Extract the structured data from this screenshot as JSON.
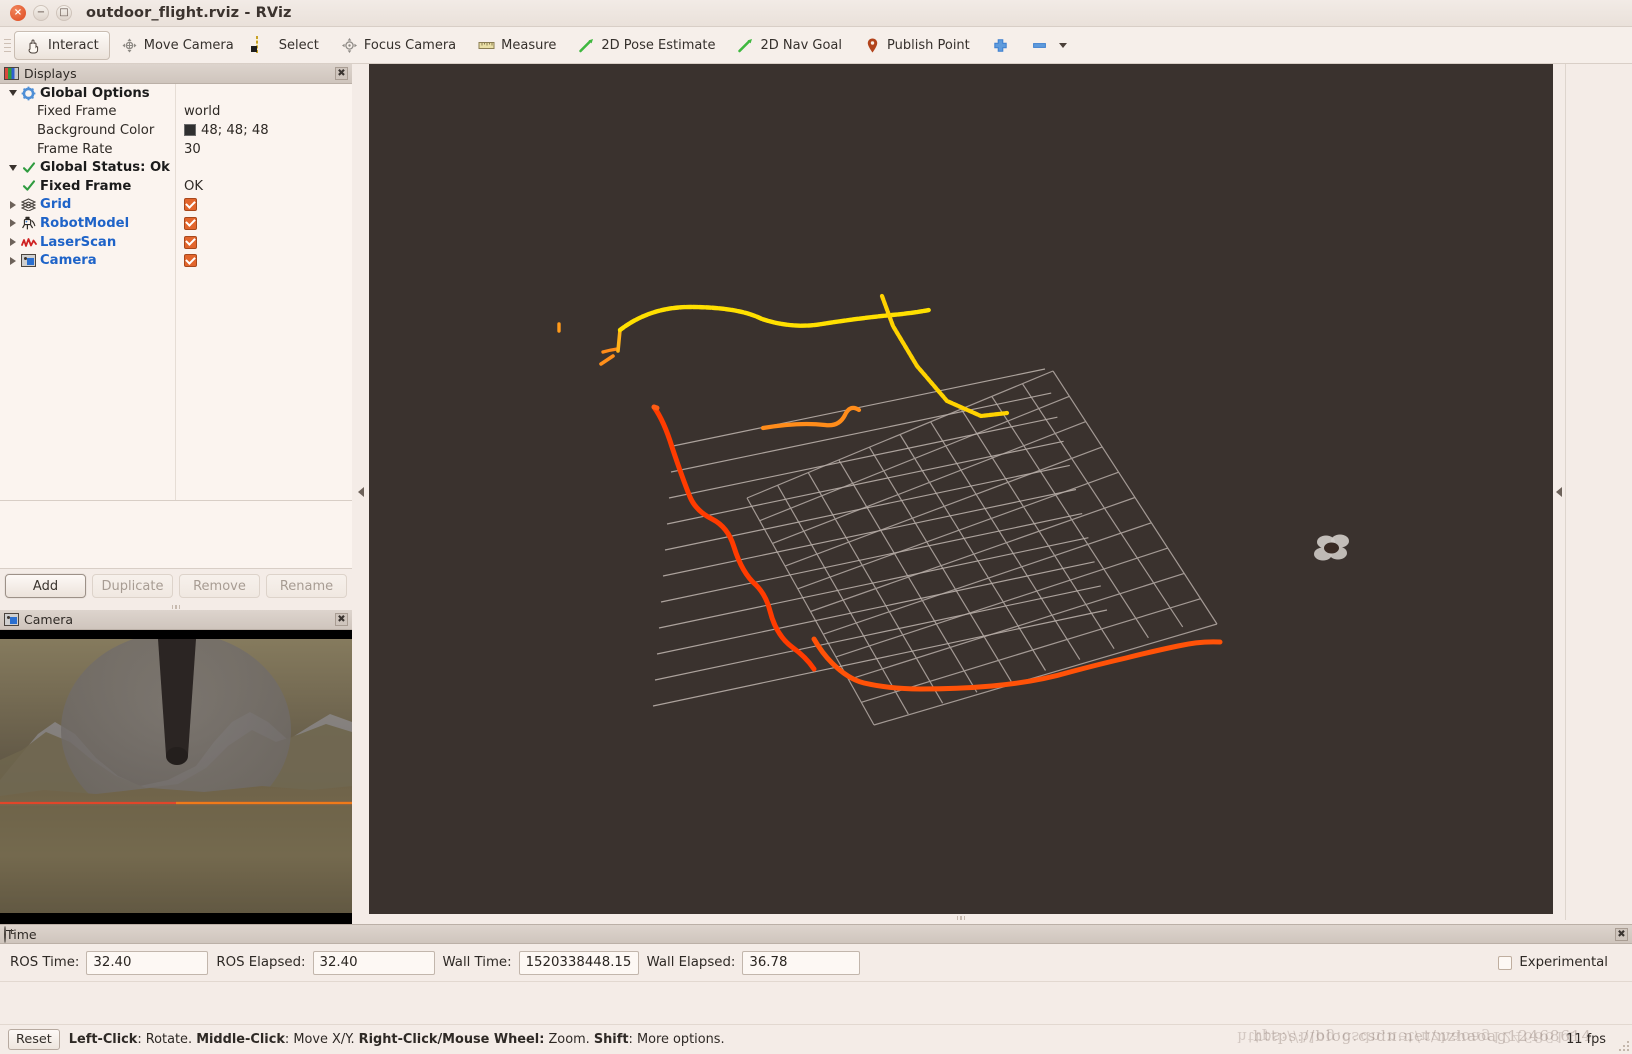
{
  "window": {
    "title": "outdoor_flight.rviz - RViz",
    "controls": {
      "close": "×",
      "minimize": "−",
      "maximize": "□"
    }
  },
  "toolbar": {
    "items": [
      {
        "label": "Interact",
        "icon": "hand-icon",
        "active": true
      },
      {
        "label": "Move Camera",
        "icon": "move-camera-icon",
        "active": false
      },
      {
        "label": "Select",
        "icon": "select-icon",
        "active": false
      },
      {
        "label": "Focus Camera",
        "icon": "focus-camera-icon",
        "active": false
      },
      {
        "label": "Measure",
        "icon": "measure-icon",
        "active": false
      },
      {
        "label": "2D Pose Estimate",
        "icon": "pose-arrow-icon",
        "active": false
      },
      {
        "label": "2D Nav Goal",
        "icon": "nav-goal-arrow-icon",
        "active": false
      },
      {
        "label": "Publish Point",
        "icon": "map-pin-icon",
        "active": false
      }
    ],
    "add_tool_icon": "plus-icon",
    "remove_tool_icon": "minus-icon",
    "remove_tool_caret": "chevron-down-icon"
  },
  "displays_panel": {
    "title": "Displays",
    "icon": "displays-icon",
    "close_label": "✖",
    "rows": [
      {
        "indent": 0,
        "twisty": "down",
        "icon": "gear-icon",
        "name": "Global Options",
        "style": "bold",
        "value": "",
        "value_type": "none"
      },
      {
        "indent": 1,
        "twisty": "none",
        "icon": "none",
        "name": "Fixed Frame",
        "style": "plain",
        "value": "world",
        "value_type": "text"
      },
      {
        "indent": 1,
        "twisty": "none",
        "icon": "none",
        "name": "Background Color",
        "style": "plain",
        "value": "48; 48; 48",
        "value_type": "color",
        "color": "#303030"
      },
      {
        "indent": 1,
        "twisty": "none",
        "icon": "none",
        "name": "Frame Rate",
        "style": "plain",
        "value": "30",
        "value_type": "text"
      },
      {
        "indent": 0,
        "twisty": "down",
        "icon": "check-green-icon",
        "name": "Global Status: Ok",
        "style": "bold",
        "value": "",
        "value_type": "none"
      },
      {
        "indent": 1,
        "twisty": "none",
        "icon": "check-green-icon",
        "name": "Fixed Frame",
        "style": "bold",
        "value": "OK",
        "value_type": "text"
      },
      {
        "indent": 0,
        "twisty": "right",
        "icon": "grid-icon",
        "name": "Grid",
        "style": "link",
        "value": "",
        "value_type": "checkbox"
      },
      {
        "indent": 0,
        "twisty": "right",
        "icon": "robot-icon",
        "name": "RobotModel",
        "style": "link",
        "value": "",
        "value_type": "checkbox"
      },
      {
        "indent": 0,
        "twisty": "right",
        "icon": "laserscan-icon",
        "name": "LaserScan",
        "style": "link",
        "value": "",
        "value_type": "checkbox"
      },
      {
        "indent": 0,
        "twisty": "right",
        "icon": "camera-icon",
        "name": "Camera",
        "style": "link",
        "value": "",
        "value_type": "checkbox"
      }
    ],
    "buttons": [
      {
        "label": "Add",
        "enabled": true
      },
      {
        "label": "Duplicate",
        "enabled": false
      },
      {
        "label": "Remove",
        "enabled": false
      },
      {
        "label": "Rename",
        "enabled": false
      }
    ]
  },
  "camera_panel": {
    "title": "Camera",
    "icon": "camera-icon",
    "close_label": "✖"
  },
  "time_panel": {
    "title": "Time",
    "icon": "clock-icon",
    "close_label": "✖",
    "fields": [
      {
        "label": "ROS Time:",
        "value": "32.40"
      },
      {
        "label": "ROS Elapsed:",
        "value": "32.40"
      },
      {
        "label": "Wall Time:",
        "value": "1520338448.15"
      },
      {
        "label": "Wall Elapsed:",
        "value": "36.78"
      }
    ],
    "experimental": {
      "label": "Experimental",
      "checked": false
    }
  },
  "status_bar": {
    "reset_label": "Reset",
    "hint_segments": [
      {
        "text": "Left-Click",
        "bold": true
      },
      {
        "text": ": Rotate. ",
        "bold": false
      },
      {
        "text": "Middle-Click",
        "bold": true
      },
      {
        "text": ": Move X/Y. ",
        "bold": false
      },
      {
        "text": "Right-Click/Mouse Wheel:",
        "bold": true
      },
      {
        "text": " Zoom. ",
        "bold": false
      },
      {
        "text": "Shift",
        "bold": true
      },
      {
        "text": ": More options.",
        "bold": false
      }
    ],
    "fps": "11 fps",
    "watermark": "https://blog.csdn.net/nzhaoag12468614"
  },
  "viewport": {
    "background_color": "#3a322e",
    "grid": {
      "cells": 10,
      "line_color": "#b6aca6"
    },
    "robot": {
      "name": "quadrotor",
      "body_color": "#3a2b24",
      "rotor_color": "#c9c4bf"
    },
    "laserscan": {
      "point_color_near": "#ff4500",
      "point_color_far": "#ffe000"
    },
    "paths": [
      {
        "name": "yellow-scan-upper",
        "color": "#ffe000"
      },
      {
        "name": "yellow-scan-right",
        "color": "#ffd000"
      },
      {
        "name": "orange-scan-mid",
        "color": "#ff8c1a"
      },
      {
        "name": "red-scan-left",
        "color": "#ff3b00"
      },
      {
        "name": "red-scan-bottom",
        "color": "#ff5208"
      }
    ],
    "collapse_arrow": "chevron-left-icon"
  }
}
